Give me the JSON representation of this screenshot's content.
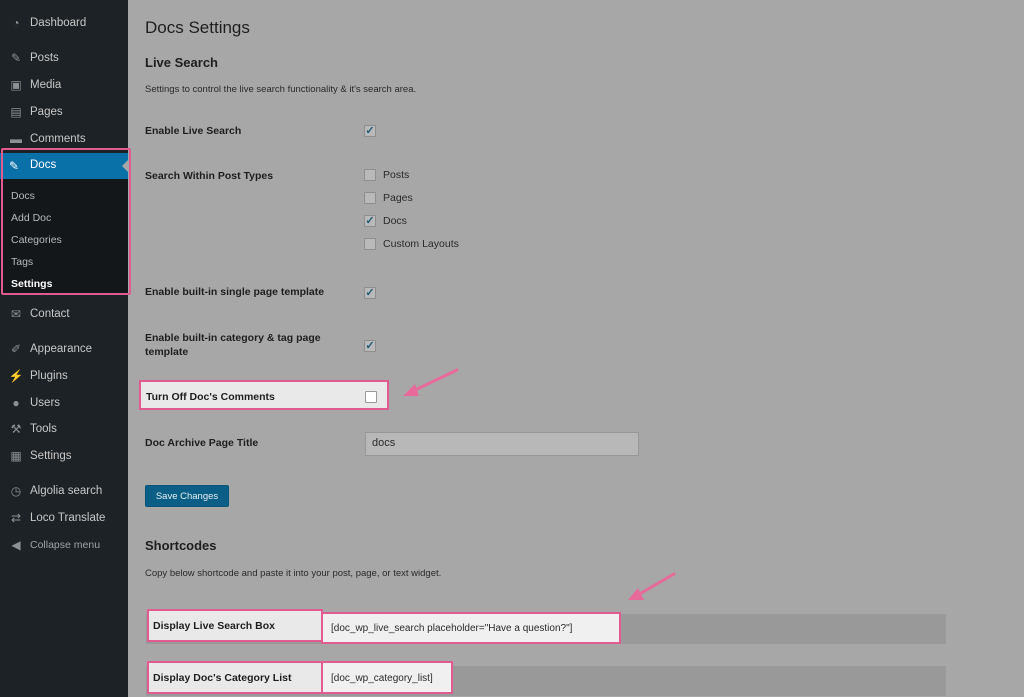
{
  "sidebar": {
    "items": [
      {
        "label": "Dashboard",
        "icon": "dashboard-icon"
      },
      {
        "label": "Posts",
        "icon": "pin-icon"
      },
      {
        "label": "Media",
        "icon": "media-icon"
      },
      {
        "label": "Pages",
        "icon": "pages-icon"
      },
      {
        "label": "Comments",
        "icon": "comment-icon"
      },
      {
        "label": "Docs",
        "icon": "pin-icon"
      },
      {
        "label": "Contact",
        "icon": "mail-icon"
      },
      {
        "label": "Appearance",
        "icon": "brush-icon"
      },
      {
        "label": "Plugins",
        "icon": "plugin-icon"
      },
      {
        "label": "Users",
        "icon": "user-icon"
      },
      {
        "label": "Tools",
        "icon": "wrench-icon"
      },
      {
        "label": "Settings",
        "icon": "settings-icon"
      },
      {
        "label": "Algolia search",
        "icon": "stopwatch-icon"
      },
      {
        "label": "Loco Translate",
        "icon": "translate-icon"
      },
      {
        "label": "Collapse menu",
        "icon": "collapse-icon"
      }
    ],
    "docs_submenu": [
      "Docs",
      "Add Doc",
      "Categories",
      "Tags",
      "Settings"
    ]
  },
  "main": {
    "title": "Docs Settings",
    "live_search": {
      "heading": "Live Search",
      "description": "Settings to control the live search functionality & it's search area.",
      "enable_label": "Enable Live Search",
      "post_types_label": "Search Within Post Types",
      "post_types": [
        {
          "label": "Posts",
          "checked": false
        },
        {
          "label": "Pages",
          "checked": false
        },
        {
          "label": "Docs",
          "checked": true
        },
        {
          "label": "Custom Layouts",
          "checked": false
        }
      ],
      "single_template_label": "Enable built-in single page template",
      "category_template_label_1": "Enable built-in category & tag page",
      "category_template_label_2": "template",
      "comments_label": "Turn Off Doc's Comments",
      "archive_title_label": "Doc Archive Page Title",
      "archive_title_value": "docs",
      "save_label": "Save Changes"
    },
    "shortcodes": {
      "heading": "Shortcodes",
      "description": "Copy below shortcode and paste it into your post, page, or text widget.",
      "rows": [
        {
          "label": "Display Live Search Box",
          "code": "[doc_wp_live_search placeholder=\"Have a question?\"]"
        },
        {
          "label": "Display Doc's Category List",
          "code": "[doc_wp_category_list]"
        }
      ]
    }
  },
  "colors": {
    "highlight": "#e05b8f",
    "active_menu": "#0a70a8",
    "sidebar_bg": "#1d2226"
  }
}
